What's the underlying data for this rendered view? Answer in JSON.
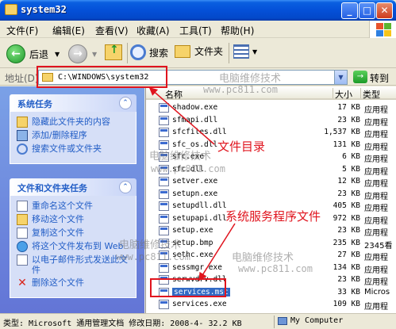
{
  "window": {
    "title": "system32"
  },
  "menu": [
    "文件(F)",
    "编辑(E)",
    "查看(V)",
    "收藏(A)",
    "工具(T)",
    "帮助(H)"
  ],
  "toolbar": {
    "back": "后退",
    "search": "搜索",
    "folders": "文件夹"
  },
  "address": {
    "label": "地址(D)",
    "path": "C:\\WINDOWS\\system32",
    "go": "转到"
  },
  "system_tasks": {
    "title": "系统任务",
    "items": [
      "隐藏此文件夹的内容",
      "添加/删除程序",
      "搜索文件或文件夹"
    ]
  },
  "file_folder_tasks": {
    "title": "文件和文件夹任务",
    "items": [
      "重命名这个文件",
      "移动这个文件",
      "复制这个文件",
      "将这个文件发布到 Web",
      "以电子邮件形式发送此文件",
      "删除这个文件"
    ]
  },
  "columns": {
    "name": "名称",
    "size": "大小",
    "type": "类型"
  },
  "files": [
    {
      "name": "shadow.exe",
      "size": "17 KB",
      "type": "应用程"
    },
    {
      "name": "sfmapi.dll",
      "size": "23 KB",
      "type": "应用程"
    },
    {
      "name": "sfcfiles.dll",
      "size": "1,537 KB",
      "type": "应用程"
    },
    {
      "name": "sfc_os.dll",
      "size": "131 KB",
      "type": "应用程"
    },
    {
      "name": "sfc.exe",
      "size": "6 KB",
      "type": "应用程"
    },
    {
      "name": "sfc.dll",
      "size": "5 KB",
      "type": "应用程"
    },
    {
      "name": "setver.exe",
      "size": "12 KB",
      "type": "应用程"
    },
    {
      "name": "setupn.exe",
      "size": "23 KB",
      "type": "应用程"
    },
    {
      "name": "setupdll.dll",
      "size": "405 KB",
      "type": "应用程"
    },
    {
      "name": "setupapi.dll",
      "size": "972 KB",
      "type": "应用程"
    },
    {
      "name": "setup.exe",
      "size": "23 KB",
      "type": "应用程"
    },
    {
      "name": "setup.bmp",
      "size": "235 KB",
      "type": "2345看"
    },
    {
      "name": "sethc.exe",
      "size": "27 KB",
      "type": "应用程"
    },
    {
      "name": "sessmgr.exe",
      "size": "134 KB",
      "type": "应用程"
    },
    {
      "name": "serwvdrv.dll",
      "size": "23 KB",
      "type": "应用程"
    },
    {
      "name": "services.msc",
      "size": "33 KB",
      "type": "Micros"
    },
    {
      "name": "services.exe",
      "size": "109 KB",
      "type": "应用程"
    }
  ],
  "selected_index": 15,
  "status": {
    "text": "类型: Microsoft 通用管理文档 修改日期: 2008-4- 32.2 KB",
    "computer": "My Computer"
  },
  "annotations": {
    "file_dir": "文件目录",
    "service_prog": "系统服务程序文件"
  },
  "watermarks": {
    "cn": "电脑维修技术",
    "url": "www.pc811.com"
  },
  "colors": {
    "annotation_red": "#e0141e",
    "title_blue": "#0450d8",
    "task_link": "#215dc6",
    "selection": "#316ac5"
  }
}
